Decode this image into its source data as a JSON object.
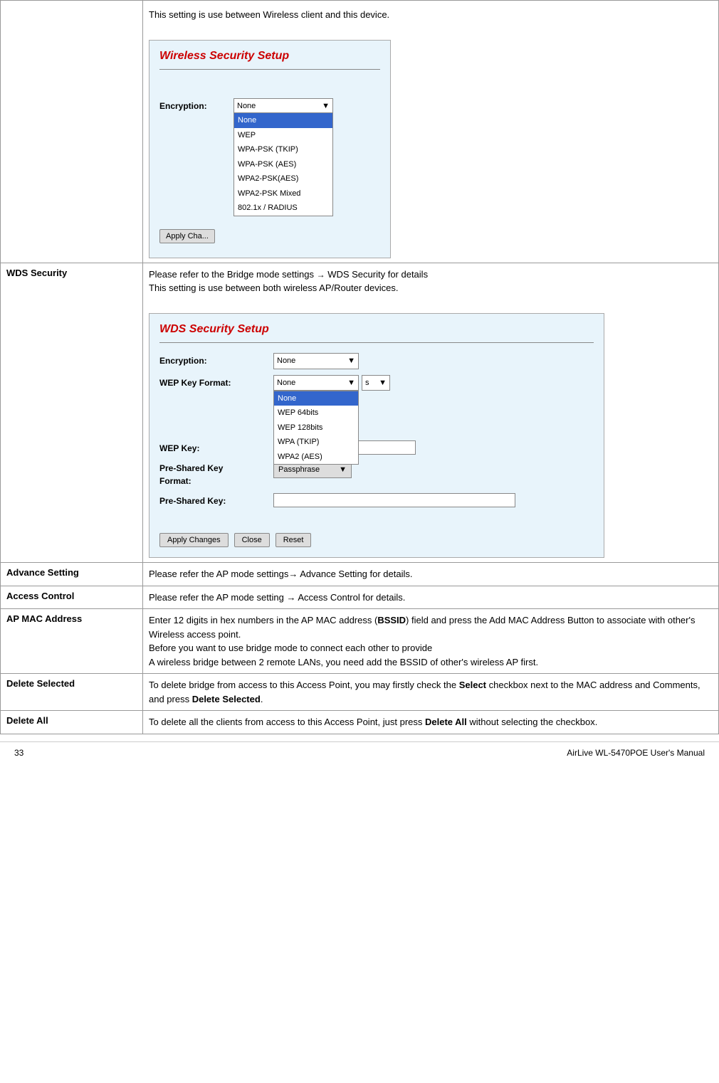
{
  "page": {
    "footer": {
      "page_number": "33",
      "product_name": "AirLive WL-5470POE User's Manual"
    }
  },
  "table": {
    "rows": [
      {
        "id": "wireless-security-row",
        "label": "",
        "content_intro": "This setting is use between Wireless client and this device.",
        "wss": {
          "title": "Wireless Security Setup",
          "encryption_label": "Encryption:",
          "encryption_value": "None",
          "dropdown_items": [
            "None",
            "WEP",
            "WPA-PSK (TKIP)",
            "WPA-PSK (AES)",
            "WPA2-PSK(AES)",
            "WPA2-PSK Mixed",
            "802.1x / RADIUS"
          ],
          "selected_item": "None",
          "apply_button": "Apply Cha..."
        }
      },
      {
        "id": "wds-security-row",
        "label": "WDS Security",
        "content_line1": "Please refer to the Bridge mode settings → WDS Security for details",
        "content_line2": "This setting is use between both wireless AP/Router devices.",
        "wds": {
          "title": "WDS Security Setup",
          "fields": [
            {
              "label": "Encryption:",
              "type": "select",
              "value": "None"
            },
            {
              "label": "WEP Key Format:",
              "type": "select_open",
              "value": "None",
              "dropdown": [
                "None",
                "WEP 64bits",
                "WEP 128bits",
                "WPA (TKIP)",
                "WPA2 (AES)"
              ]
            },
            {
              "label": "WEP Key:",
              "type": "input",
              "value": ""
            },
            {
              "label": "Pre-Shared Key Format:",
              "type": "select_passphrase",
              "value": "Passphrase"
            },
            {
              "label": "Pre-Shared Key:",
              "type": "input_wide",
              "value": ""
            }
          ],
          "buttons": [
            "Apply Changes",
            "Close",
            "Reset"
          ]
        }
      },
      {
        "id": "advance-setting-row",
        "label": "Advance Setting",
        "content": "Please refer the AP mode settings→ Advance Setting for details."
      },
      {
        "id": "access-control-row",
        "label": "Access Control",
        "content": "Please refer the AP mode setting → Access Control for details."
      },
      {
        "id": "ap-mac-address-row",
        "label": "AP MAC Address",
        "content_parts": [
          {
            "text": "Enter 12 digits in hex numbers in the AP MAC address (",
            "bold_text": "",
            "is_plain": true
          },
          {
            "text": "BSSID",
            "is_bold": true
          },
          {
            "text": ") field and press the Add MAC Address Button to associate with other's Wireless access point.",
            "is_plain": true
          },
          {
            "text": "Before you want to use bridge mode to connect each other to provide",
            "is_plain": true,
            "newline": true
          },
          {
            "text": "A wireless bridge between 2 remote LANs, you need add the BSSID of other's wireless AP first.",
            "is_plain": true,
            "newline": true
          }
        ]
      },
      {
        "id": "delete-selected-row",
        "label": "Delete Selected",
        "content_prefix": "To delete bridge from access to this Access Point, you may firstly check the ",
        "content_bold1": "Select",
        "content_mid": " checkbox next to the MAC address and Comments, and press ",
        "content_bold2": "Delete Selected",
        "content_suffix": "."
      },
      {
        "id": "delete-all-row",
        "label": "Delete All",
        "content_prefix": "To delete all the clients from access to this Access Point, just press ",
        "content_bold1": "Delete All",
        "content_suffix": " without selecting the checkbox."
      }
    ]
  }
}
